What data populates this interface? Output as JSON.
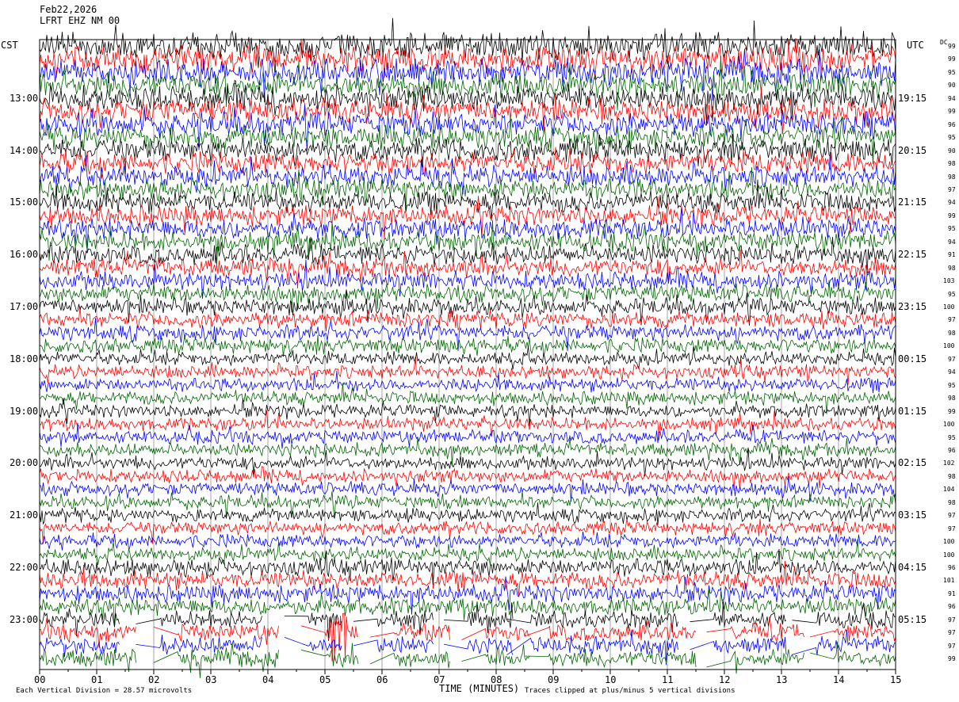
{
  "header": {
    "date": "Feb22,2026",
    "station": "LFRT EHZ NM 00"
  },
  "labels": {
    "left_zone": "CST",
    "right_zone": "UTC",
    "dc_header": "DC",
    "xlabel": "TIME (MINUTES)",
    "footer_scale": "Each Vertical Division =   28.57 microvolts",
    "footer_clip": "Traces clipped at plus/minus 5 vertical divisions"
  },
  "chart_data": {
    "type": "line",
    "title": "Feb22,2026 LFRT EHZ NM 00",
    "xlabel": "TIME (MINUTES)",
    "x_ticks": [
      "00",
      "01",
      "02",
      "03",
      "04",
      "05",
      "06",
      "07",
      "08",
      "09",
      "10",
      "11",
      "12",
      "13",
      "14",
      "15"
    ],
    "xlim": [
      0,
      15
    ],
    "left_time_labels": [
      "13:00",
      "14:00",
      "15:00",
      "16:00",
      "17:00",
      "18:00",
      "19:00",
      "20:00",
      "21:00",
      "22:00",
      "23:00"
    ],
    "right_time_labels": [
      "19:15",
      "20:15",
      "21:15",
      "22:15",
      "23:15",
      "00:15",
      "01:15",
      "02:15",
      "03:15",
      "04:15",
      "05:15"
    ],
    "trace_colors": [
      "#000000",
      "#ff0000",
      "#0000ff",
      "#006400"
    ],
    "dc_values": [
      99,
      99,
      95,
      90,
      94,
      99,
      96,
      95,
      90,
      98,
      98,
      97,
      94,
      99,
      95,
      94,
      91,
      98,
      103,
      95,
      100,
      97,
      98,
      100,
      97,
      94,
      95,
      98,
      99,
      100,
      95,
      96,
      102,
      98,
      104,
      98,
      97,
      97,
      100,
      100,
      96,
      101,
      91,
      96,
      97,
      97,
      97,
      99
    ],
    "vertical_division_microvolts": 28.57,
    "clip_divisions": 5,
    "gaps_in_last_traces": true
  }
}
